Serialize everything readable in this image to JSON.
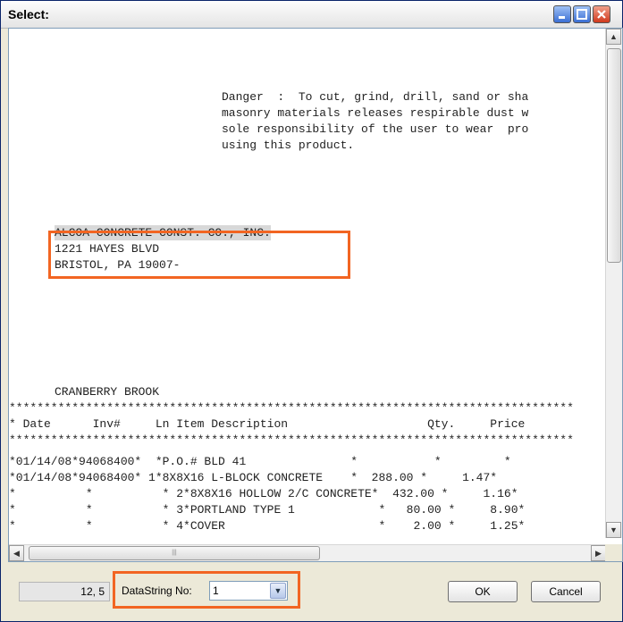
{
  "window": {
    "title": "Select:"
  },
  "document_lines": [
    "Danger  :  To cut, grind, drill, sand or sha",
    "masonry materials releases respirable dust w",
    "sole responsibility of the user to wear  pro",
    "using this product.",
    "ALCOA CONCRETE CONST. CO., INC.",
    "1221 HAYES BLVD",
    "BRISTOL, PA 19007-",
    "CRANBERRY BROOK",
    "*********************************************************************************",
    "* Date      Inv#     Ln Item Description                    Qty.     Price",
    "*********************************************************************************",
    "*01/14/08*94068400*  *P.O.# BLD 41               *           *         *",
    "*01/14/08*94068400* 1*8X8X16 L-BLOCK CONCRETE    *  288.00 *     1.47*",
    "*          *          * 2*8X8X16 HOLLOW 2/C CONCRETE*  432.00 *     1.16*",
    "*          *          * 3*PORTLAND TYPE 1            *   80.00 *     8.90*",
    "*          *          * 4*COVER                      *    2.00 *     1.25*"
  ],
  "bottom": {
    "position_readout": "12, 5",
    "datastring_label": "DataString No:",
    "datastring_value": "1",
    "ok_label": "OK",
    "cancel_label": "Cancel"
  },
  "colors": {
    "highlight_box": "#f26522",
    "selection_highlight": "#d8d8d8"
  }
}
